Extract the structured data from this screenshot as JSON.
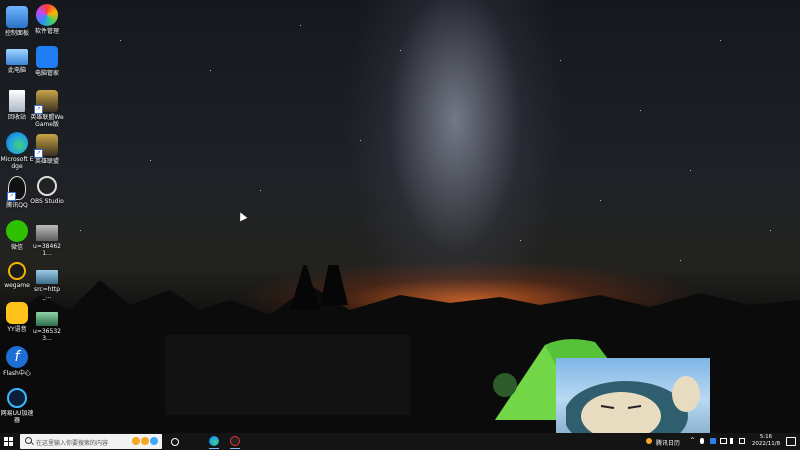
{
  "desktop": {
    "icons": [
      {
        "label": "控制面板",
        "icon": "control-panel-icon"
      },
      {
        "label": "软件管理",
        "icon": "software-manager-icon"
      },
      {
        "label": "此电脑",
        "icon": "computer-icon"
      },
      {
        "label": "电脑管家",
        "icon": "pc-manager-icon"
      },
      {
        "label": "回收站",
        "icon": "recycle-bin-icon"
      },
      {
        "label": "英雄联盟WeGame版",
        "icon": "lol-wegame-icon"
      },
      {
        "label": "Microsoft Edge",
        "icon": "edge-icon"
      },
      {
        "label": "英雄联盟",
        "icon": "lol-icon"
      },
      {
        "label": "腾讯QQ",
        "icon": "qq-icon"
      },
      {
        "label": "OBS Studio",
        "icon": "obs-icon"
      },
      {
        "label": "微信",
        "icon": "wechat-icon"
      },
      {
        "label": "u=384621...",
        "icon": "image-file-icon"
      },
      {
        "label": "wegame",
        "icon": "wegame-icon"
      },
      {
        "label": "src=http_...",
        "icon": "image-file-icon"
      },
      {
        "label": "YY语音",
        "icon": "yy-icon"
      },
      {
        "label": "u=365323...",
        "icon": "image-file-icon"
      },
      {
        "label": "Flash中心",
        "icon": "flash-icon"
      },
      {
        "label": "网易UU加速器",
        "icon": "uu-accelerator-icon"
      }
    ]
  },
  "taskbar": {
    "search_placeholder": "在这里输入你要搜索的内容",
    "pinned_apps": [
      {
        "name": "Microsoft Edge",
        "icon": "edge-icon"
      },
      {
        "name": "OBS Studio",
        "icon": "obs-icon"
      }
    ],
    "tray_label": "腾讯日历",
    "time": "5:16",
    "date": "2022/11/8"
  },
  "colors": {
    "taskbar": "#141414",
    "edge_accent": "#1fa0e8",
    "sunset": "#e0691f"
  }
}
